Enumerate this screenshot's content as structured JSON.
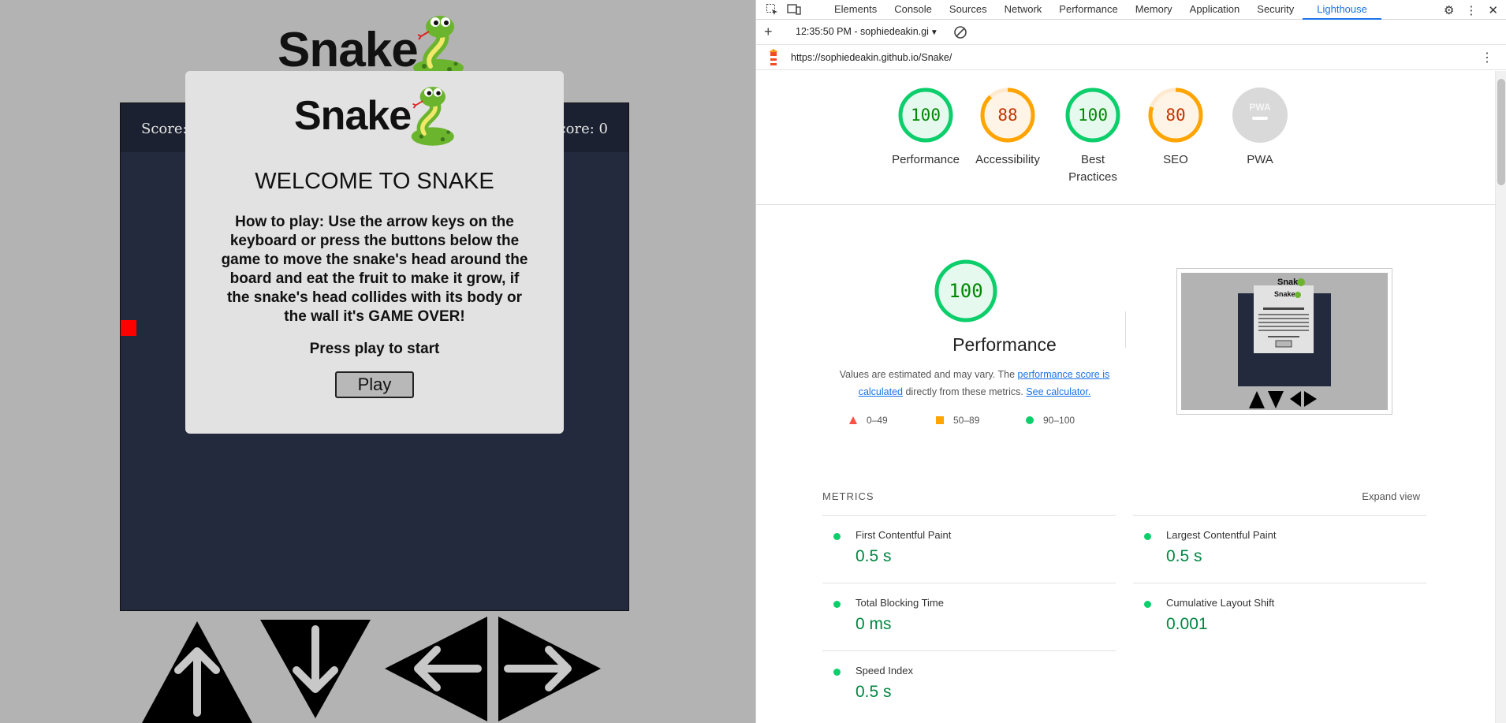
{
  "game": {
    "logo_text": "Snake",
    "score_label": "Score: 0",
    "high_score_label": "High Score: 0",
    "modal": {
      "logo_text": "Snake",
      "title": "WELCOME TO SNAKE",
      "instructions": "How to play: Use the arrow keys on the keyboard or press the buttons below the game to move the snake's head around the board and eat the fruit to make it grow, if the snake's head collides with its body or the wall it's GAME OVER!",
      "press_text": "Press play to start",
      "play_label": "Play"
    },
    "controls": [
      "up-arrow",
      "down-arrow",
      "left-arrow",
      "right-arrow"
    ]
  },
  "devtools": {
    "tabs": [
      "Elements",
      "Console",
      "Sources",
      "Network",
      "Performance",
      "Memory",
      "Application",
      "Security",
      "Lighthouse"
    ],
    "active_tab": "Lighthouse",
    "report_select": "12:35:50 PM - sophiedeakin.gi",
    "url": "https://sophiedeakin.github.io/Snake/",
    "scores": [
      {
        "label": "Performance",
        "value": "100",
        "score": 100,
        "color": "#0cce6b"
      },
      {
        "label": "Accessibility",
        "value": "88",
        "score": 88,
        "color": "#ffa400"
      },
      {
        "label": "Best Practices",
        "value": "100",
        "score": 100,
        "color": "#0cce6b"
      },
      {
        "label": "SEO",
        "value": "80",
        "score": 80,
        "color": "#ffa400"
      },
      {
        "label": "PWA",
        "value": "PWA",
        "score": null,
        "color": "#cccccc"
      }
    ],
    "performance": {
      "score": "100",
      "title": "Performance",
      "desc_prefix": "Values are estimated and may vary. The ",
      "desc_link1": "performance score is calculated",
      "desc_middle": " directly from these metrics. ",
      "desc_link2": "See calculator.",
      "legend": [
        {
          "range": "0–49",
          "color": "#ff4e42",
          "shape": "triangle"
        },
        {
          "range": "50–89",
          "color": "#ffa400",
          "shape": "square"
        },
        {
          "range": "90–100",
          "color": "#0cce6b",
          "shape": "circle"
        }
      ]
    },
    "metrics": {
      "title": "METRICS",
      "expand": "Expand view",
      "items": [
        {
          "name": "First Contentful Paint",
          "value": "0.5 s"
        },
        {
          "name": "Largest Contentful Paint",
          "value": "0.5 s"
        },
        {
          "name": "Total Blocking Time",
          "value": "0 ms"
        },
        {
          "name": "Cumulative Layout Shift",
          "value": "0.001"
        },
        {
          "name": "Speed Index",
          "value": "0.5 s"
        }
      ]
    }
  }
}
